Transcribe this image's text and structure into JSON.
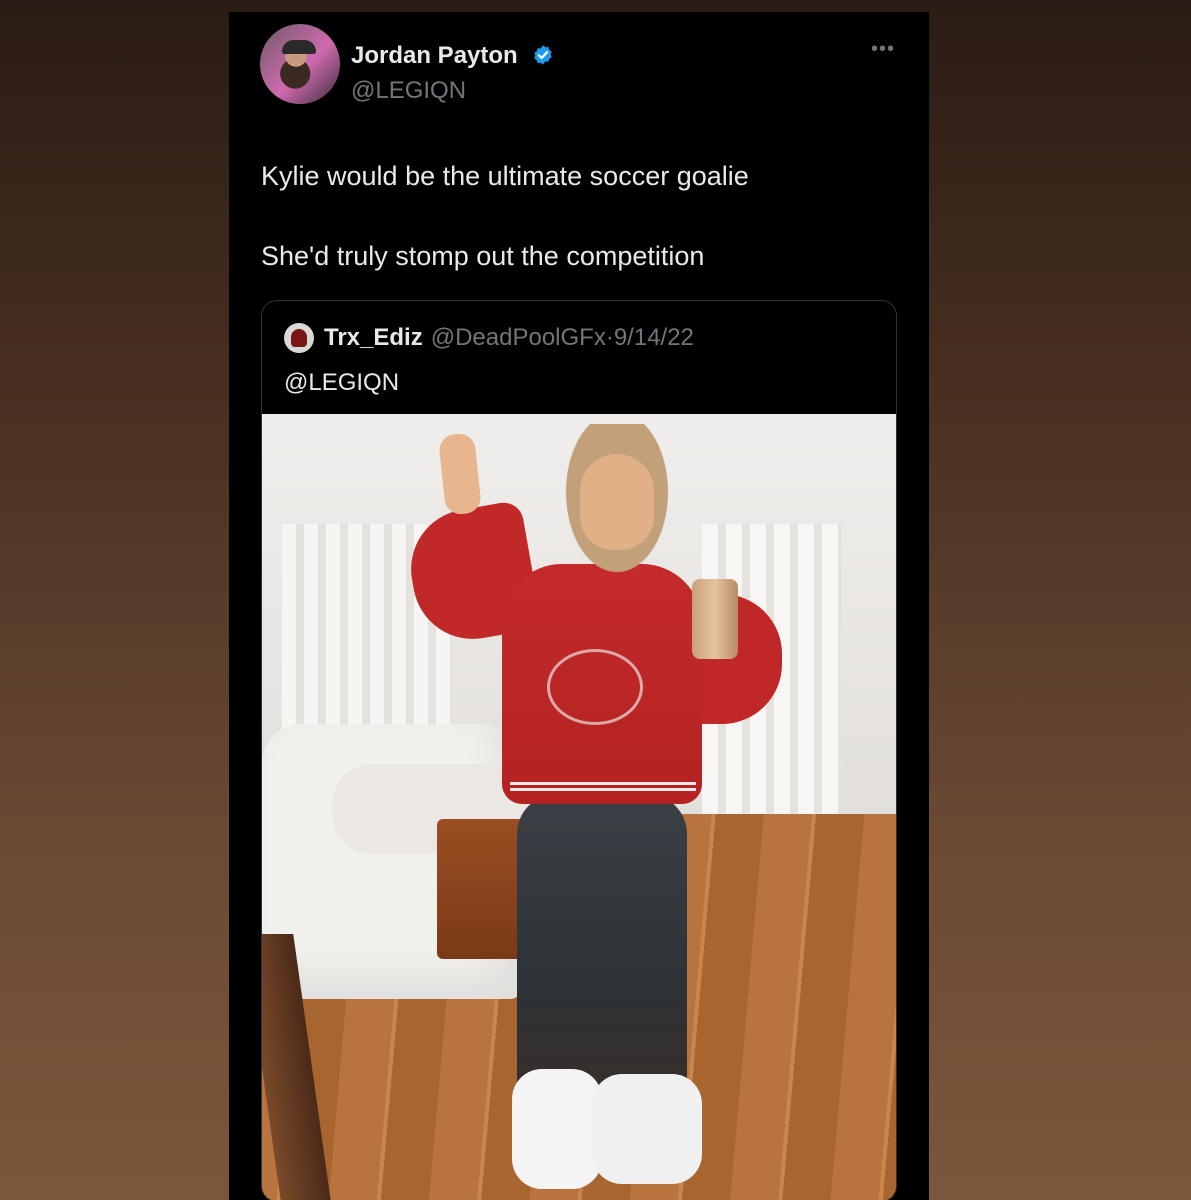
{
  "tweet": {
    "author": {
      "display_name": "Jordan Payton",
      "handle": "@LEGIQN",
      "verified": true
    },
    "more_icon": "more-horizontal-icon",
    "lines": [
      "Kylie would be the ultimate soccer goalie",
      "She'd truly stomp out the competition"
    ],
    "quoted": {
      "name": "Trx_Ediz",
      "handle": "@DeadPoolGFx",
      "separator": "·",
      "date": "9/14/22",
      "text": "@LEGIQN"
    }
  },
  "colors": {
    "card_bg": "#000000",
    "primary_text": "#e7e9ea",
    "secondary_text": "#71767b",
    "verified_blue": "#1d9bf0",
    "border": "#2f3336"
  }
}
